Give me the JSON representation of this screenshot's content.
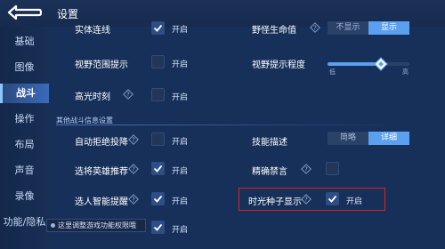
{
  "header": {
    "title": "设置"
  },
  "sidebar": {
    "items": [
      {
        "label": "基础",
        "active": false
      },
      {
        "label": "图像",
        "active": false
      },
      {
        "label": "战斗",
        "active": true
      },
      {
        "label": "操作",
        "active": false
      },
      {
        "label": "布局",
        "active": false
      },
      {
        "label": "声音",
        "active": false
      },
      {
        "label": "录像",
        "active": false
      },
      {
        "label": "功能/隐私",
        "active": false
      }
    ]
  },
  "settings": {
    "row_top_left": {
      "label": "实体连线",
      "checked": true,
      "option": "开启"
    },
    "row_top_right": {
      "label": "野怪生命值",
      "options": [
        "不显示",
        "显示"
      ],
      "selected": "显示"
    },
    "vision_range_hint": {
      "label": "视野范围提示",
      "checked": false,
      "option": "开启"
    },
    "vision_hint_level": {
      "label": "视野提示程度",
      "low": "低",
      "high": "高",
      "level": 0.65
    },
    "highlight_moment": {
      "label": "高光时刻",
      "checked": false,
      "option": "开启"
    },
    "section_title": "其他战斗信息设置",
    "auto_reject_surrender": {
      "label": "自动拒绝投降",
      "checked": false,
      "option": "开启"
    },
    "skill_description": {
      "label": "技能描述",
      "options": [
        "简略",
        "详细"
      ],
      "selected": "详细"
    },
    "hero_recommend": {
      "label": "选将英雄推荐",
      "checked": true,
      "option": "开启"
    },
    "precise_ban": {
      "label": "精确禁言",
      "checked": false,
      "option": "开启"
    },
    "smart_remind": {
      "label": "选人智能提醒",
      "checked": true,
      "option": "开启"
    },
    "time_seed_display": {
      "label": "时光种子显示",
      "checked": true,
      "option": "开启"
    },
    "bottom_row": {
      "checked": true,
      "option": "开启"
    }
  },
  "tooltip": {
    "text": "这里调整游戏功能权限哦"
  },
  "colors": {
    "accent": "#5aa0ee",
    "highlight_border": "#e02222",
    "background": "#17305a"
  }
}
